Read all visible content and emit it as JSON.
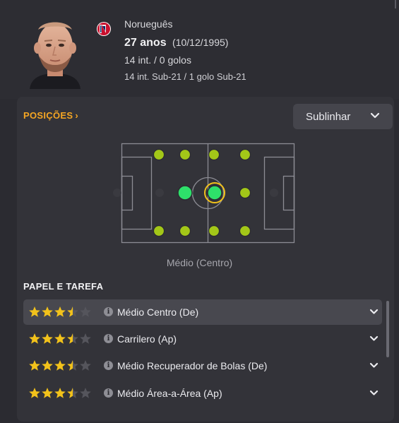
{
  "player": {
    "nationality": "Norueguês",
    "age": "27 anos",
    "dob": "(10/12/1995)",
    "caps": "14 int. / 0 golos",
    "u21": "14 int. Sub-21 / 1 golo Sub-21",
    "flag_colors": [
      "#c8102e",
      "#ffffff",
      "#002868"
    ]
  },
  "positions": {
    "title": "POSIÇÕES",
    "chevron_icon": "chevron-right-icon",
    "highlight_button": "Sublinhar",
    "selected_position": "Médio (Centro)"
  },
  "roles": {
    "title": "PAPEL E TAREFA",
    "items": [
      {
        "name": "Médio Centro (De)",
        "stars": 3.5,
        "selected": true
      },
      {
        "name": "Carrilero (Ap)",
        "stars": 3.5,
        "selected": false
      },
      {
        "name": "Médio Recuperador de Bolas (De)",
        "stars": 3.5,
        "selected": false
      },
      {
        "name": "Médio Área-a-Área (Ap)",
        "stars": 3.5,
        "selected": false
      }
    ]
  },
  "colors": {
    "accent": "#f5a623",
    "star": "#f2c21b",
    "position_natural": "#2ee06a",
    "position_accomplished": "#a3c718",
    "pitch_lines": "#8c8c94"
  }
}
